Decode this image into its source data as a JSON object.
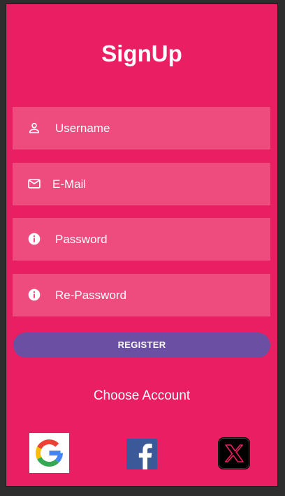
{
  "header": {
    "title": "SignUp"
  },
  "form": {
    "username_placeholder": "Username",
    "email_placeholder": "E-Mail",
    "password_placeholder": "Password",
    "repassword_placeholder": "Re-Password",
    "register_label": "REGISTER"
  },
  "social": {
    "choose_label": "Choose Account",
    "providers": [
      {
        "icon": "google-icon"
      },
      {
        "icon": "facebook-icon"
      },
      {
        "icon": "x-icon"
      }
    ]
  },
  "colors": {
    "background": "#e91e63",
    "field": "#ee4c7f",
    "button": "#6a4fa3",
    "text": "#ffffff"
  }
}
